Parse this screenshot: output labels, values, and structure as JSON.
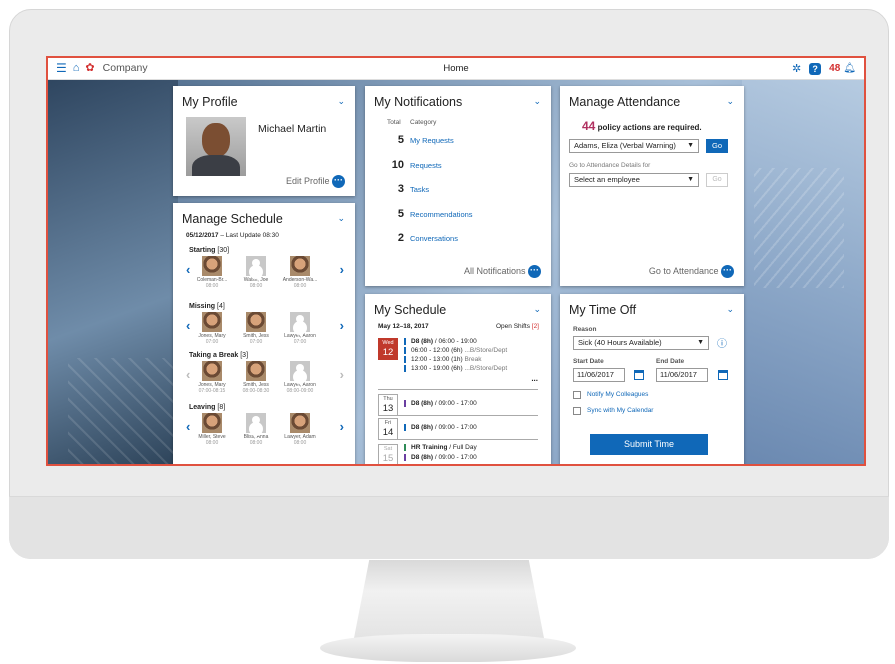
{
  "topbar": {
    "company": "Company",
    "title": "Home",
    "alert_count": "48",
    "help_label": "?"
  },
  "profile": {
    "title": "My Profile",
    "name": "Michael Martin",
    "edit_label": "Edit Profile"
  },
  "manage_schedule": {
    "title": "Manage Schedule",
    "date": "05/12/2017",
    "last_update": "– Last Update 08:30",
    "groups": [
      {
        "label": "Starting",
        "count": "[30]",
        "people": [
          {
            "name": "Coleman-Br...",
            "time": "08:00"
          },
          {
            "name": "Walsh, Joe",
            "time": "08:00"
          },
          {
            "name": "Anderson-Wa...",
            "time": "08:00"
          }
        ]
      },
      {
        "label": "Missing",
        "count": "[4]",
        "people": [
          {
            "name": "Jones, Mary",
            "time": "07:00"
          },
          {
            "name": "Smith, Jess",
            "time": "07:00"
          },
          {
            "name": "Lawyer, Aaron",
            "time": "07:00"
          }
        ]
      },
      {
        "label": "Taking a Break",
        "count": "[3]",
        "people": [
          {
            "name": "Jones, Mary",
            "time": "07:00-08:15"
          },
          {
            "name": "Smith, Jess",
            "time": "08:00-08:30"
          },
          {
            "name": "Lawyer, Aaron",
            "time": "08:00-09:00"
          }
        ]
      },
      {
        "label": "Leaving",
        "count": "[8]",
        "people": [
          {
            "name": "Miller, Steve",
            "time": "08:00"
          },
          {
            "name": "Bliss, Anna",
            "time": "08:00"
          },
          {
            "name": "Lawyer, Adam",
            "time": "08:00"
          }
        ]
      }
    ]
  },
  "notifications": {
    "title": "My Notifications",
    "col_total": "Total",
    "col_category": "Category",
    "rows": [
      {
        "total": "5",
        "category": "My Requests"
      },
      {
        "total": "10",
        "category": "Requests"
      },
      {
        "total": "3",
        "category": "Tasks"
      },
      {
        "total": "5",
        "category": "Recommendations"
      },
      {
        "total": "2",
        "category": "Conversations"
      }
    ],
    "all_label": "All Notifications"
  },
  "attendance": {
    "title": "Manage Attendance",
    "count": "44",
    "message": "policy actions are required.",
    "employee_select": "Adams, Eliza (Verbal Warning)",
    "go_label": "Go",
    "details_label": "Go to Attendance Details for",
    "details_placeholder": "Select an employee",
    "footer_label": "Go to Attendance"
  },
  "my_schedule": {
    "title": "My Schedule",
    "range": "May 12–18, 2017",
    "open_shifts_label": "Open Shifts",
    "open_shifts_count": "[2]",
    "days": [
      {
        "dow": "Wed",
        "day": "12",
        "lines": [
          {
            "bold": "D8 (8h)",
            "text": " / 06:00 - 19:00",
            "sub": ""
          },
          {
            "bold": "",
            "text": "06:00 - 12:00 (6h)",
            "sub": " ...B/Store/Dept"
          },
          {
            "bold": "",
            "text": "12:00 - 13:00 (1h)",
            "sub": " Break"
          },
          {
            "bold": "",
            "text": "13:00 - 19:00 (6h)",
            "sub": " ...B/Store/Dept"
          }
        ]
      },
      {
        "dow": "Thu",
        "day": "13",
        "lines": [
          {
            "bold": "D8 (8h)",
            "text": " / 09:00 - 17:00",
            "sub": ""
          }
        ]
      },
      {
        "dow": "Fri",
        "day": "14",
        "lines": [
          {
            "bold": "D8 (8h)",
            "text": " / 09:00 - 17:00",
            "sub": ""
          }
        ]
      },
      {
        "dow": "Sat",
        "day": "15",
        "lines": [
          {
            "bold": "HR Training",
            "text": " / Full Day",
            "sub": ""
          },
          {
            "bold": "D8 (8h)",
            "text": " / 09:00 - 17:00",
            "sub": ""
          }
        ]
      }
    ],
    "ellipsis": "..."
  },
  "time_off": {
    "title": "My Time Off",
    "reason_label": "Reason",
    "reason_value": "Sick (40 Hours Available)",
    "start_label": "Start Date",
    "end_label": "End Date",
    "start_value": "11/06/2017",
    "end_value": "11/06/2017",
    "notify_label": "Notify My Colleagues",
    "sync_label": "Sync with My Calendar",
    "submit_label": "Submit Time"
  },
  "colors": {
    "accent": "#1068b8",
    "alert": "#d32f2f",
    "today": "#c0392b",
    "frame_highlight": "#e0513f"
  }
}
